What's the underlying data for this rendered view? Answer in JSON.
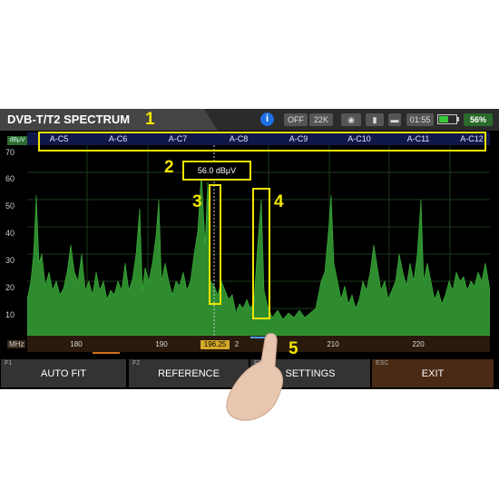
{
  "app": {
    "title": "DVB-T/T2 SPECTRUM"
  },
  "status_bar": {
    "info_icon": "info-icon",
    "lnb_power": "OFF",
    "tone": "22K",
    "time": "01:55",
    "battery_level": 0.56,
    "battery_percent": "56%"
  },
  "channels": [
    "A-C5",
    "A-C6",
    "A-C7",
    "A-C8",
    "A-C9",
    "A-C10",
    "A-C11",
    "A-C12"
  ],
  "marker": {
    "readout": "56.0 dBμV",
    "frequency": "196.25"
  },
  "axis": {
    "y_unit": "dBμV",
    "y_ticks": [
      "70",
      "60",
      "50",
      "40",
      "30",
      "20",
      "10"
    ],
    "x_unit": "MHz",
    "x_ticks": [
      "180",
      "190",
      "210",
      "220"
    ],
    "x_partial": "2"
  },
  "softkeys": [
    {
      "fn": "F1",
      "label": "AUTO FIT"
    },
    {
      "fn": "F2",
      "label": "REFERENCE"
    },
    {
      "fn": "F3",
      "label": "SETTINGS"
    },
    {
      "fn": "ESC",
      "label": "EXIT"
    }
  ],
  "annotations": {
    "n1": "1",
    "n2": "2",
    "n3": "3",
    "n4": "4",
    "n5": "5"
  },
  "colors": {
    "accent": "#f2e500",
    "spectrum": "#2e8b2e",
    "marker": "#d6a92a"
  }
}
